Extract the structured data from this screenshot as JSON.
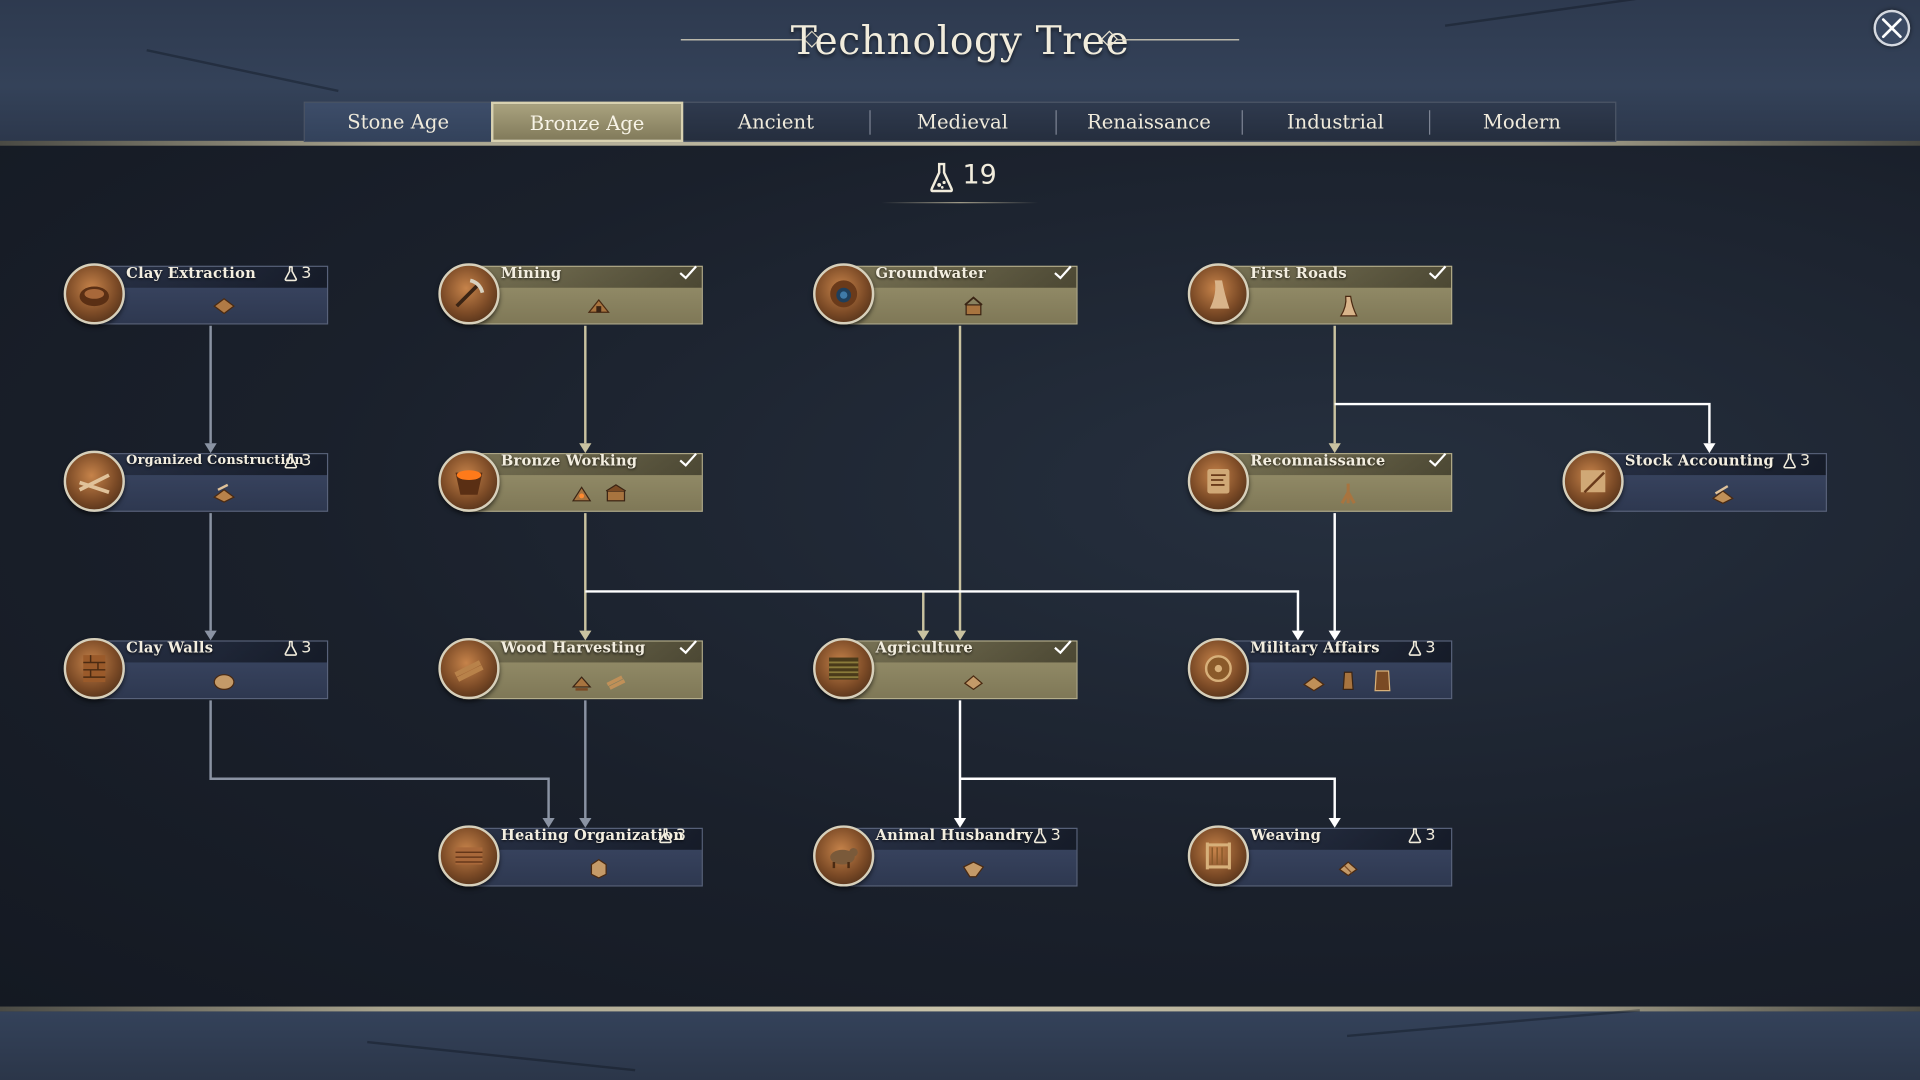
{
  "title": "Technology Tree",
  "research_points": "19",
  "tabs": [
    {
      "label": "Stone Age",
      "state": "done"
    },
    {
      "label": "Bronze Age",
      "state": "active"
    },
    {
      "label": "Ancient",
      "state": "locked"
    },
    {
      "label": "Medieval",
      "state": "locked"
    },
    {
      "label": "Renaissance",
      "state": "locked"
    },
    {
      "label": "Industrial",
      "state": "locked"
    },
    {
      "label": "Modern",
      "state": "locked"
    }
  ],
  "techs": {
    "clay_extraction": {
      "name": "Clay Extraction",
      "researched": false,
      "cost": "3",
      "unlock_icons": [
        "clay-pit-icon"
      ]
    },
    "mining": {
      "name": "Mining",
      "researched": true,
      "cost": "",
      "unlock_icons": [
        "mine-icon"
      ]
    },
    "groundwater": {
      "name": "Groundwater",
      "researched": true,
      "cost": "",
      "unlock_icons": [
        "well-icon"
      ]
    },
    "first_roads": {
      "name": "First Roads",
      "researched": true,
      "cost": "",
      "unlock_icons": [
        "road-icon"
      ]
    },
    "organized_construction": {
      "name": "Organized Construction",
      "researched": false,
      "cost": "3",
      "unlock_icons": [
        "builder-icon"
      ]
    },
    "bronze_working": {
      "name": "Bronze Working",
      "researched": true,
      "cost": "",
      "unlock_icons": [
        "smelter-icon",
        "workshop-icon"
      ]
    },
    "reconnaissance": {
      "name": "Reconnaissance",
      "researched": true,
      "cost": "",
      "unlock_icons": [
        "scout-icon"
      ]
    },
    "stock_accounting": {
      "name": "Stock Accounting",
      "researched": false,
      "cost": "3",
      "unlock_icons": [
        "storehouse-icon"
      ]
    },
    "clay_walls": {
      "name": "Clay Walls",
      "researched": false,
      "cost": "3",
      "unlock_icons": [
        "wall-icon"
      ]
    },
    "wood_harvesting": {
      "name": "Wood Harvesting",
      "researched": true,
      "cost": "",
      "unlock_icons": [
        "woodcutter-icon",
        "log-icon"
      ]
    },
    "agriculture": {
      "name": "Agriculture",
      "researched": true,
      "cost": "",
      "unlock_icons": [
        "farm-icon"
      ]
    },
    "military_affairs": {
      "name": "Military Affairs",
      "researched": false,
      "cost": "3",
      "unlock_icons": [
        "barracks-icon",
        "weapon-icon",
        "shield-icon"
      ]
    },
    "heating_organization": {
      "name": "Heating Organization",
      "researched": false,
      "cost": "3",
      "unlock_icons": [
        "firewood-icon"
      ]
    },
    "animal_husbandry": {
      "name": "Animal Husbandry",
      "researched": false,
      "cost": "3",
      "unlock_icons": [
        "pasture-icon"
      ]
    },
    "weaving": {
      "name": "Weaving",
      "researched": false,
      "cost": "3",
      "unlock_icons": [
        "loom-icon"
      ]
    }
  },
  "colors": {
    "researched_link": "#c9c2a0",
    "available_link": "#ffffff",
    "locked_link": "#8a93a3"
  }
}
